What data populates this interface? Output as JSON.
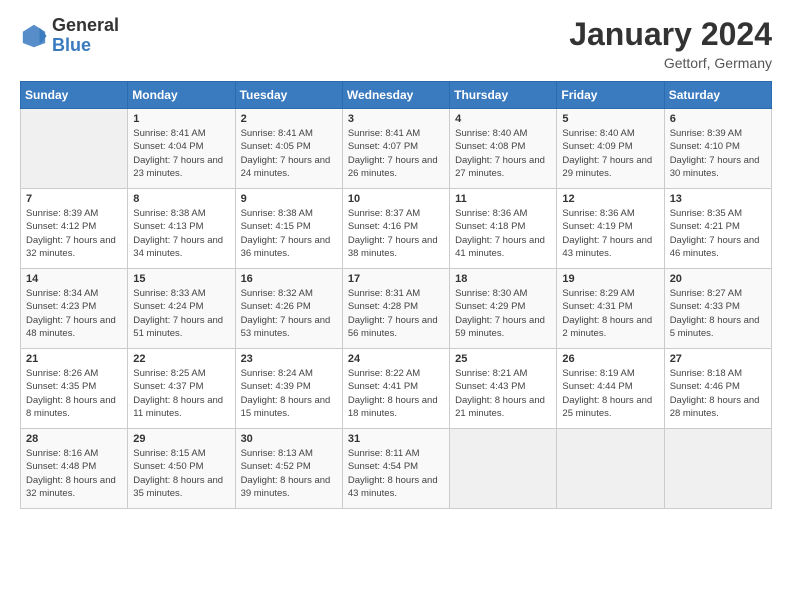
{
  "logo": {
    "general": "General",
    "blue": "Blue"
  },
  "title": "January 2024",
  "location": "Gettorf, Germany",
  "days_of_week": [
    "Sunday",
    "Monday",
    "Tuesday",
    "Wednesday",
    "Thursday",
    "Friday",
    "Saturday"
  ],
  "weeks": [
    [
      {
        "day": "",
        "empty": true
      },
      {
        "day": "1",
        "sunrise": "Sunrise: 8:41 AM",
        "sunset": "Sunset: 4:04 PM",
        "daylight": "Daylight: 7 hours and 23 minutes."
      },
      {
        "day": "2",
        "sunrise": "Sunrise: 8:41 AM",
        "sunset": "Sunset: 4:05 PM",
        "daylight": "Daylight: 7 hours and 24 minutes."
      },
      {
        "day": "3",
        "sunrise": "Sunrise: 8:41 AM",
        "sunset": "Sunset: 4:07 PM",
        "daylight": "Daylight: 7 hours and 26 minutes."
      },
      {
        "day": "4",
        "sunrise": "Sunrise: 8:40 AM",
        "sunset": "Sunset: 4:08 PM",
        "daylight": "Daylight: 7 hours and 27 minutes."
      },
      {
        "day": "5",
        "sunrise": "Sunrise: 8:40 AM",
        "sunset": "Sunset: 4:09 PM",
        "daylight": "Daylight: 7 hours and 29 minutes."
      },
      {
        "day": "6",
        "sunrise": "Sunrise: 8:39 AM",
        "sunset": "Sunset: 4:10 PM",
        "daylight": "Daylight: 7 hours and 30 minutes."
      }
    ],
    [
      {
        "day": "7",
        "sunrise": "Sunrise: 8:39 AM",
        "sunset": "Sunset: 4:12 PM",
        "daylight": "Daylight: 7 hours and 32 minutes."
      },
      {
        "day": "8",
        "sunrise": "Sunrise: 8:38 AM",
        "sunset": "Sunset: 4:13 PM",
        "daylight": "Daylight: 7 hours and 34 minutes."
      },
      {
        "day": "9",
        "sunrise": "Sunrise: 8:38 AM",
        "sunset": "Sunset: 4:15 PM",
        "daylight": "Daylight: 7 hours and 36 minutes."
      },
      {
        "day": "10",
        "sunrise": "Sunrise: 8:37 AM",
        "sunset": "Sunset: 4:16 PM",
        "daylight": "Daylight: 7 hours and 38 minutes."
      },
      {
        "day": "11",
        "sunrise": "Sunrise: 8:36 AM",
        "sunset": "Sunset: 4:18 PM",
        "daylight": "Daylight: 7 hours and 41 minutes."
      },
      {
        "day": "12",
        "sunrise": "Sunrise: 8:36 AM",
        "sunset": "Sunset: 4:19 PM",
        "daylight": "Daylight: 7 hours and 43 minutes."
      },
      {
        "day": "13",
        "sunrise": "Sunrise: 8:35 AM",
        "sunset": "Sunset: 4:21 PM",
        "daylight": "Daylight: 7 hours and 46 minutes."
      }
    ],
    [
      {
        "day": "14",
        "sunrise": "Sunrise: 8:34 AM",
        "sunset": "Sunset: 4:23 PM",
        "daylight": "Daylight: 7 hours and 48 minutes."
      },
      {
        "day": "15",
        "sunrise": "Sunrise: 8:33 AM",
        "sunset": "Sunset: 4:24 PM",
        "daylight": "Daylight: 7 hours and 51 minutes."
      },
      {
        "day": "16",
        "sunrise": "Sunrise: 8:32 AM",
        "sunset": "Sunset: 4:26 PM",
        "daylight": "Daylight: 7 hours and 53 minutes."
      },
      {
        "day": "17",
        "sunrise": "Sunrise: 8:31 AM",
        "sunset": "Sunset: 4:28 PM",
        "daylight": "Daylight: 7 hours and 56 minutes."
      },
      {
        "day": "18",
        "sunrise": "Sunrise: 8:30 AM",
        "sunset": "Sunset: 4:29 PM",
        "daylight": "Daylight: 7 hours and 59 minutes."
      },
      {
        "day": "19",
        "sunrise": "Sunrise: 8:29 AM",
        "sunset": "Sunset: 4:31 PM",
        "daylight": "Daylight: 8 hours and 2 minutes."
      },
      {
        "day": "20",
        "sunrise": "Sunrise: 8:27 AM",
        "sunset": "Sunset: 4:33 PM",
        "daylight": "Daylight: 8 hours and 5 minutes."
      }
    ],
    [
      {
        "day": "21",
        "sunrise": "Sunrise: 8:26 AM",
        "sunset": "Sunset: 4:35 PM",
        "daylight": "Daylight: 8 hours and 8 minutes."
      },
      {
        "day": "22",
        "sunrise": "Sunrise: 8:25 AM",
        "sunset": "Sunset: 4:37 PM",
        "daylight": "Daylight: 8 hours and 11 minutes."
      },
      {
        "day": "23",
        "sunrise": "Sunrise: 8:24 AM",
        "sunset": "Sunset: 4:39 PM",
        "daylight": "Daylight: 8 hours and 15 minutes."
      },
      {
        "day": "24",
        "sunrise": "Sunrise: 8:22 AM",
        "sunset": "Sunset: 4:41 PM",
        "daylight": "Daylight: 8 hours and 18 minutes."
      },
      {
        "day": "25",
        "sunrise": "Sunrise: 8:21 AM",
        "sunset": "Sunset: 4:43 PM",
        "daylight": "Daylight: 8 hours and 21 minutes."
      },
      {
        "day": "26",
        "sunrise": "Sunrise: 8:19 AM",
        "sunset": "Sunset: 4:44 PM",
        "daylight": "Daylight: 8 hours and 25 minutes."
      },
      {
        "day": "27",
        "sunrise": "Sunrise: 8:18 AM",
        "sunset": "Sunset: 4:46 PM",
        "daylight": "Daylight: 8 hours and 28 minutes."
      }
    ],
    [
      {
        "day": "28",
        "sunrise": "Sunrise: 8:16 AM",
        "sunset": "Sunset: 4:48 PM",
        "daylight": "Daylight: 8 hours and 32 minutes."
      },
      {
        "day": "29",
        "sunrise": "Sunrise: 8:15 AM",
        "sunset": "Sunset: 4:50 PM",
        "daylight": "Daylight: 8 hours and 35 minutes."
      },
      {
        "day": "30",
        "sunrise": "Sunrise: 8:13 AM",
        "sunset": "Sunset: 4:52 PM",
        "daylight": "Daylight: 8 hours and 39 minutes."
      },
      {
        "day": "31",
        "sunrise": "Sunrise: 8:11 AM",
        "sunset": "Sunset: 4:54 PM",
        "daylight": "Daylight: 8 hours and 43 minutes."
      },
      {
        "day": "",
        "empty": true
      },
      {
        "day": "",
        "empty": true
      },
      {
        "day": "",
        "empty": true
      }
    ]
  ]
}
